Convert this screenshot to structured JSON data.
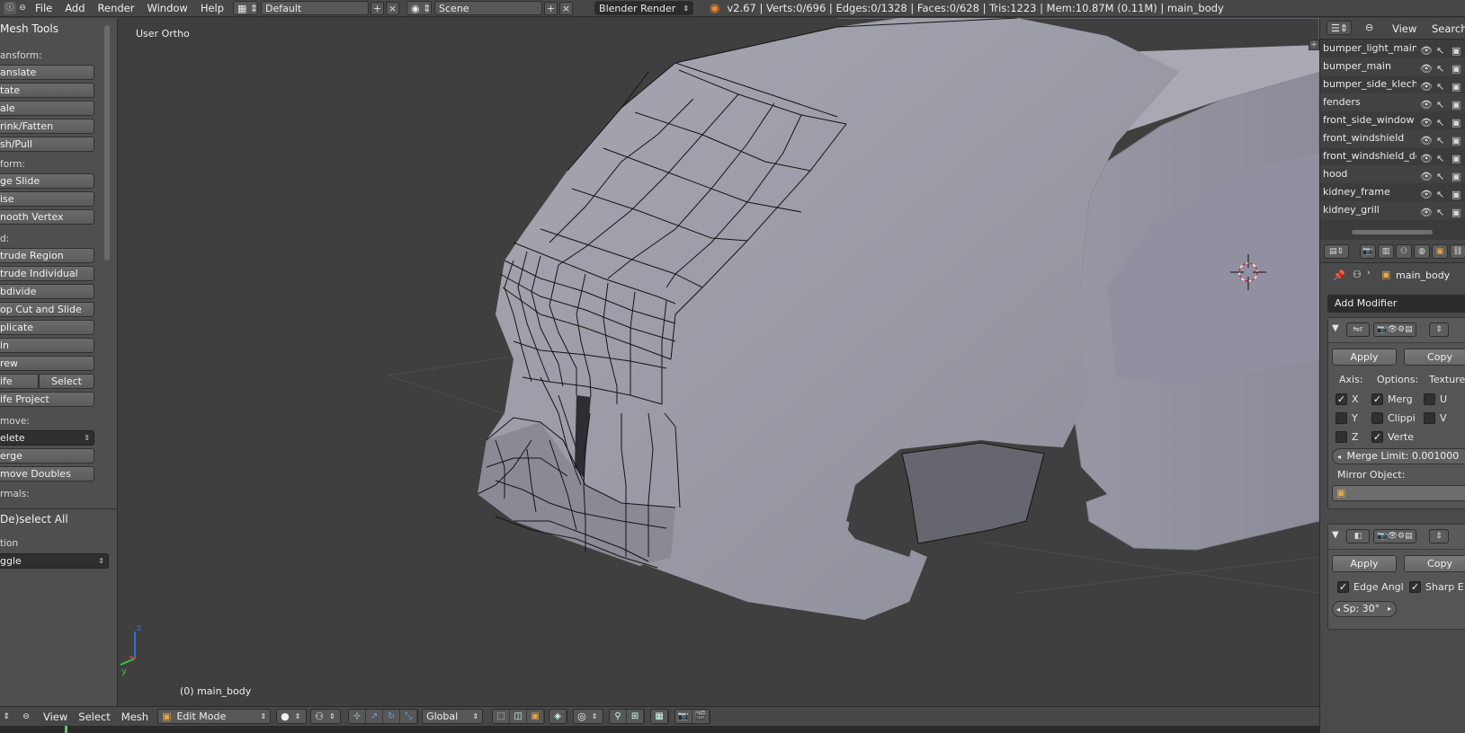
{
  "colors": {
    "viewport_bg": "#3f3f3f",
    "mesh_fill": "#9a9aa6",
    "mesh_wire": "#141414",
    "ui_panel": "#4f4f4f",
    "header": "#474747",
    "checkbox_on": "#f5f5f5"
  },
  "topbar": {
    "menu": [
      "File",
      "Add",
      "Render",
      "Window",
      "Help"
    ],
    "layout_name": "Default",
    "scene_name": "Scene",
    "render_engine": "Blender Render",
    "stats": "v2.67 | Verts:0/696 | Edges:0/1328 | Faces:0/628 | Tris:1223 | Mem:10.87M (0.11M) | main_body"
  },
  "toolshelf": {
    "panel_title": "Mesh Tools",
    "transform_label": "ansform:",
    "transform_buttons": [
      "anslate",
      "tate",
      "ale",
      "rink/Fatten",
      "sh/Pull"
    ],
    "deform_label": "form:",
    "deform_buttons": [
      "ge Slide",
      "ise",
      "nooth Vertex"
    ],
    "add_label": "d:",
    "add_buttons": [
      "trude Region",
      "trude Individual",
      "bdivide",
      "op Cut and Slide",
      "plicate",
      "in",
      "rew"
    ],
    "knife_left": "ife",
    "knife_right": "Select",
    "knife_project": "ife Project",
    "remove_label": "move:",
    "delete_value": "elete",
    "remove_buttons": [
      "erge",
      "move Doubles"
    ],
    "normals_label": "rmals:",
    "op_title": "De)select All",
    "action_label": "tion",
    "action_value": "ggle"
  },
  "viewport": {
    "view_name": "User Ortho",
    "object_label": "(0) main_body"
  },
  "bottombar": {
    "menus": [
      "View",
      "Select",
      "Mesh"
    ],
    "mode": "Edit Mode",
    "orientation": "Global"
  },
  "outliner": {
    "header": {
      "view": "View",
      "search": "Search"
    },
    "rows": [
      "bumper_light_main",
      "bumper_main",
      "bumper_side_klechki",
      "fenders",
      "front_side_window",
      "front_windshield",
      "front_windshield_dow",
      "hood",
      "kidney_frame",
      "kidney_grill"
    ]
  },
  "properties": {
    "context_object": "main_body",
    "add_modifier": "Add Modifier",
    "mirror": {
      "apply": "Apply",
      "copy": "Copy",
      "axis_label": "Axis:",
      "options_label": "Options:",
      "textures_label": "Texture",
      "axis": [
        {
          "label": "X",
          "checked": true
        },
        {
          "label": "Y",
          "checked": false
        },
        {
          "label": "Z",
          "checked": false
        }
      ],
      "options": [
        {
          "label": "Merg",
          "checked": true
        },
        {
          "label": "Clippi",
          "checked": false
        },
        {
          "label": "Verte",
          "checked": true
        }
      ],
      "textures": [
        {
          "label": "U",
          "checked": false
        },
        {
          "label": "V",
          "checked": false
        }
      ],
      "merge_limit": "Merge Limit: 0.001000",
      "mirror_object_label": "Mirror Object:"
    },
    "edgesplit": {
      "apply": "Apply",
      "copy": "Copy",
      "edge_angle": {
        "label": "Edge Angl",
        "checked": true
      },
      "sharp_edges": {
        "label": "Sharp E",
        "checked": true
      },
      "split_angle": "Sp: 30°"
    }
  }
}
